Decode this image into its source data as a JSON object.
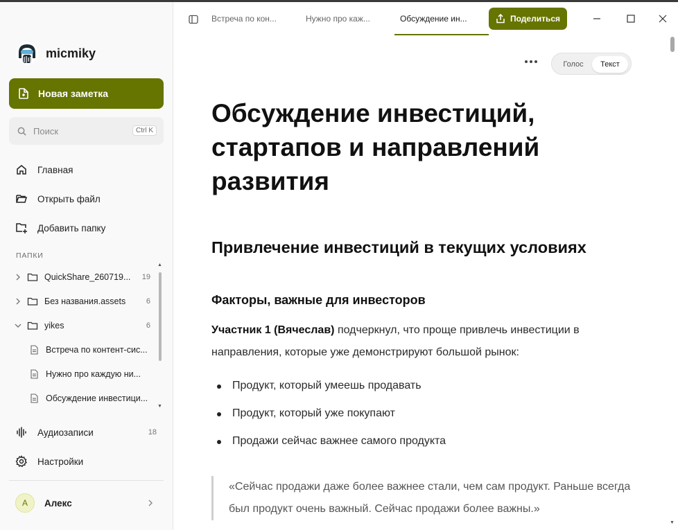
{
  "brand": {
    "name": "micmiky"
  },
  "sidebar": {
    "new_note_label": "Новая заметка",
    "search": {
      "placeholder": "Поиск",
      "shortcut": "Ctrl K"
    },
    "nav": [
      {
        "label": "Главная",
        "icon": "home-icon"
      },
      {
        "label": "Открыть файл",
        "icon": "folder-open-icon"
      },
      {
        "label": "Добавить папку",
        "icon": "folder-plus-icon"
      }
    ],
    "folders_label": "ПАПКИ",
    "tree": [
      {
        "label": "QuickShare_260719...",
        "count": "19",
        "type": "folder",
        "expanded": false
      },
      {
        "label": "Без названия.assets",
        "count": "6",
        "type": "folder",
        "expanded": false
      },
      {
        "label": "yikes",
        "count": "6",
        "type": "folder",
        "expanded": true
      },
      {
        "label": "Встреча по контент-сис...",
        "type": "document"
      },
      {
        "label": "Нужно про каждую ни...",
        "type": "document"
      },
      {
        "label": "Обсуждение инвестици...",
        "type": "document"
      }
    ],
    "audio": {
      "label": "Аудиозаписи",
      "count": "18"
    },
    "settings_label": "Настройки",
    "user": {
      "initial": "А",
      "name": "Алекс"
    }
  },
  "tabs": [
    {
      "label": "Встреча по кон...",
      "active": false
    },
    {
      "label": "Нужно про каж...",
      "active": false
    },
    {
      "label": "Обсуждение ин...",
      "active": true
    }
  ],
  "share_label": "Поделиться",
  "view_toggle": {
    "voice": "Голос",
    "text": "Текст",
    "selected": "Текст"
  },
  "document": {
    "title": "Обсуждение инвестиций, стартапов и направлений развития",
    "h2": "Привлечение инвестиций в текущих условиях",
    "h3": "Факторы, важные для инвесторов",
    "para_speaker": "Участник 1 (Вячеслав)",
    "para_text": " подчеркнул, что проще привлечь инвестиции в направления, которые уже демонстрируют большой рынок:",
    "bullets": [
      "Продукт, который умеешь продавать",
      "Продукт, который уже покупают",
      "Продажи сейчас важнее самого продукта"
    ],
    "quote": "«Сейчас продажи даже более важнее стали, чем сам продукт. Раньше всегда был продукт очень важный. Сейчас продажи более важны.»"
  },
  "colors": {
    "accent": "#667400",
    "sidebar_bg": "#f9f9f9",
    "text": "#1a1a1a"
  }
}
